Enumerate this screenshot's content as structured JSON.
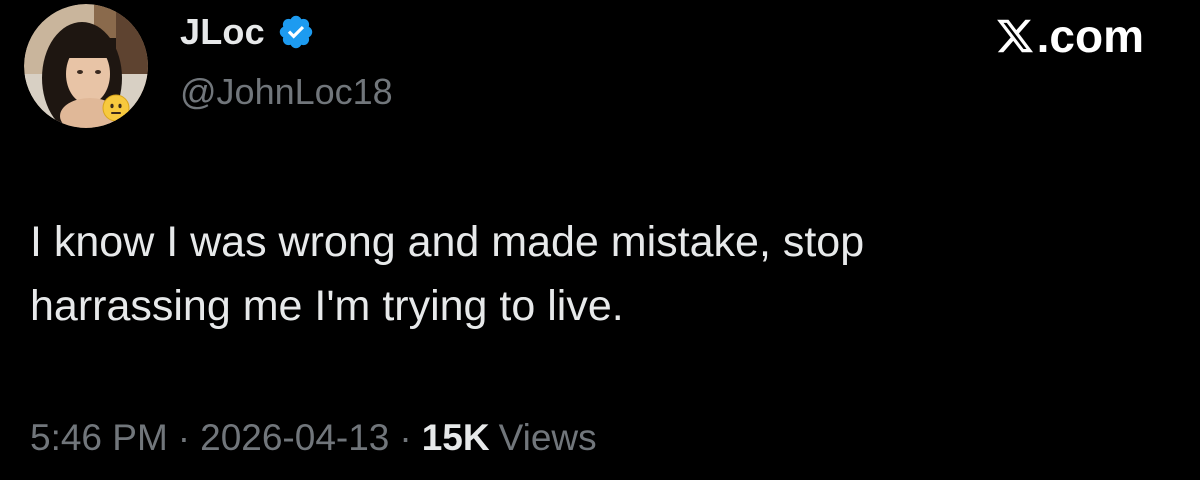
{
  "author": {
    "display_name": "JLoc",
    "handle": "@JohnLoc18",
    "verified": true,
    "avatar_badge_icon": "neutral-face-emoji-icon"
  },
  "brand": {
    "logo_icon": "x-logo-icon",
    "domain_suffix": ".com"
  },
  "tweet": {
    "text": "I know I was wrong and made mistake, stop\nharrassing me I'm trying to live."
  },
  "meta": {
    "time": "5:46 PM",
    "separator": "·",
    "date": "2026-04-13",
    "views_count": "15K",
    "views_label": "Views"
  },
  "colors": {
    "background": "#000000",
    "primary_text": "#e7e9ea",
    "secondary_text": "#71767b",
    "verified_badge": "#1d9bf0"
  }
}
